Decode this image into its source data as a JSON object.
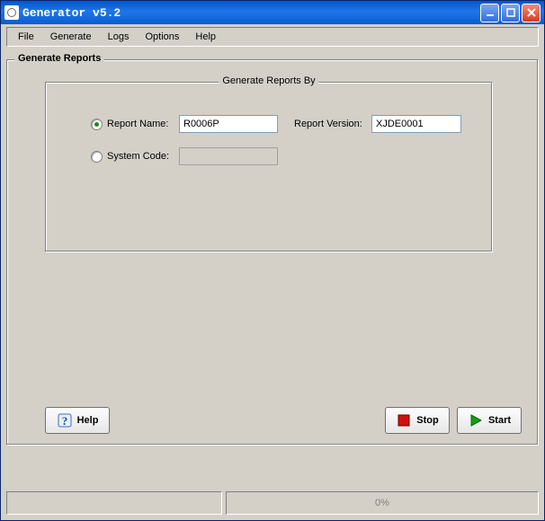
{
  "window": {
    "title": "Generator v5.2"
  },
  "menu": {
    "items": [
      "File",
      "Generate",
      "Logs",
      "Options",
      "Help"
    ]
  },
  "groups": {
    "outer_legend": "Generate Reports",
    "inner_legend": "Generate Reports By"
  },
  "fields": {
    "report_name_label": "Report Name:",
    "report_name_value": "R0006P",
    "report_version_label": "Report Version:",
    "report_version_value": "XJDE0001",
    "system_code_label": "System Code:",
    "system_code_value": ""
  },
  "radios": {
    "report_name_selected": true,
    "system_code_selected": false
  },
  "buttons": {
    "help": "Help",
    "stop": "Stop",
    "start": "Start"
  },
  "status": {
    "left": "",
    "progress_text": "0%"
  }
}
